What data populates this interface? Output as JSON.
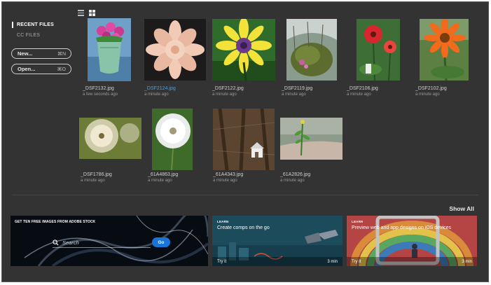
{
  "sidebar": {
    "recent_label": "RECENT FILES",
    "cc_label": "CC FILES",
    "new_label": "New...",
    "new_shortcut": "⌘N",
    "open_label": "Open...",
    "open_shortcut": "⌘O"
  },
  "view": {
    "list_icon": "list-view-icon",
    "grid_icon": "grid-view-icon",
    "selected": "grid"
  },
  "files": [
    {
      "name": "_DSF2132.jpg",
      "time": "a few seconds ago"
    },
    {
      "name": "_DSF2124.jpg",
      "time": "a minute ago",
      "active": true
    },
    {
      "name": "_DSF2122.jpg",
      "time": "a minute ago"
    },
    {
      "name": "_DSF2119.jpg",
      "time": "a minute ago"
    },
    {
      "name": "_DSF2106.jpg",
      "time": "a minute ago"
    },
    {
      "name": "_DSF2102.jpg",
      "time": "a minute ago"
    },
    {
      "name": "_DSF1786.jpg",
      "time": "a minute ago"
    },
    {
      "name": "_61A4863.jpg",
      "time": "a minute ago"
    },
    {
      "name": "_61A4343.jpg",
      "time": "a minute ago"
    },
    {
      "name": "_61A2826.jpg",
      "time": "a minute ago"
    }
  ],
  "show_all": "Show All",
  "cards": {
    "stock": {
      "title": "GET TEN FREE IMAGES FROM ADOBE STOCK",
      "search_placeholder": "Search",
      "go_label": "Go"
    },
    "comps": {
      "tag": "LEARN",
      "title": "Create comps on the go",
      "try": "Try it",
      "duration": "3 min"
    },
    "ios": {
      "tag": "LEARN",
      "title": "Preview web and app designs on iOS devices",
      "try": "Try it",
      "duration": "3 min"
    }
  },
  "colors": {
    "background": "#333333",
    "accent": "#4aa0e8",
    "go_button": "#1a73d9"
  }
}
